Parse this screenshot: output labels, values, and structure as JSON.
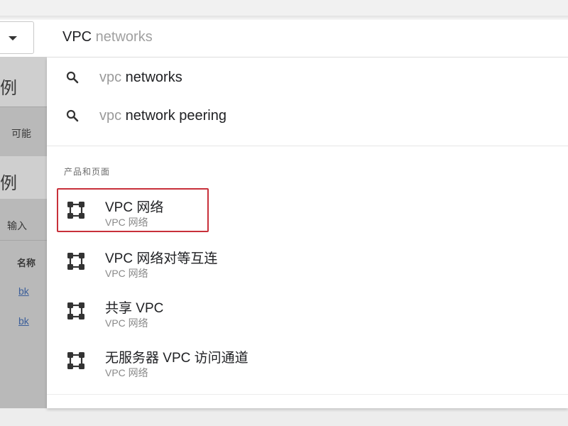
{
  "search": {
    "typed": "VPC",
    "ghost": " networks"
  },
  "suggestions": [
    {
      "dim": "vpc",
      "strong": " networks"
    },
    {
      "dim": "vpc",
      "strong": " network peering"
    }
  ],
  "section_title": "产品和页面",
  "products": [
    {
      "title": "VPC 网络",
      "subtitle": "VPC 网络",
      "icon": "network-icon",
      "highlighted": true
    },
    {
      "title": "VPC 网络对等互连",
      "subtitle": "VPC 网络",
      "icon": "network-icon",
      "highlighted": false
    },
    {
      "title": "共享 VPC",
      "subtitle": "VPC 网络",
      "icon": "network-icon",
      "highlighted": false
    },
    {
      "title": "无服务器 VPC 访问通道",
      "subtitle": "VPC 网络",
      "icon": "network-icon",
      "highlighted": false
    }
  ],
  "background": {
    "heading_1": "例",
    "text_1": "可能",
    "heading_2": "例",
    "input_placeholder": "输入",
    "col_header": "名称",
    "link_1": "bk",
    "link_2": "bk"
  },
  "colors": {
    "highlight": "#c8303a",
    "ghost_text": "#a0a0a0",
    "icon": "#333333"
  }
}
